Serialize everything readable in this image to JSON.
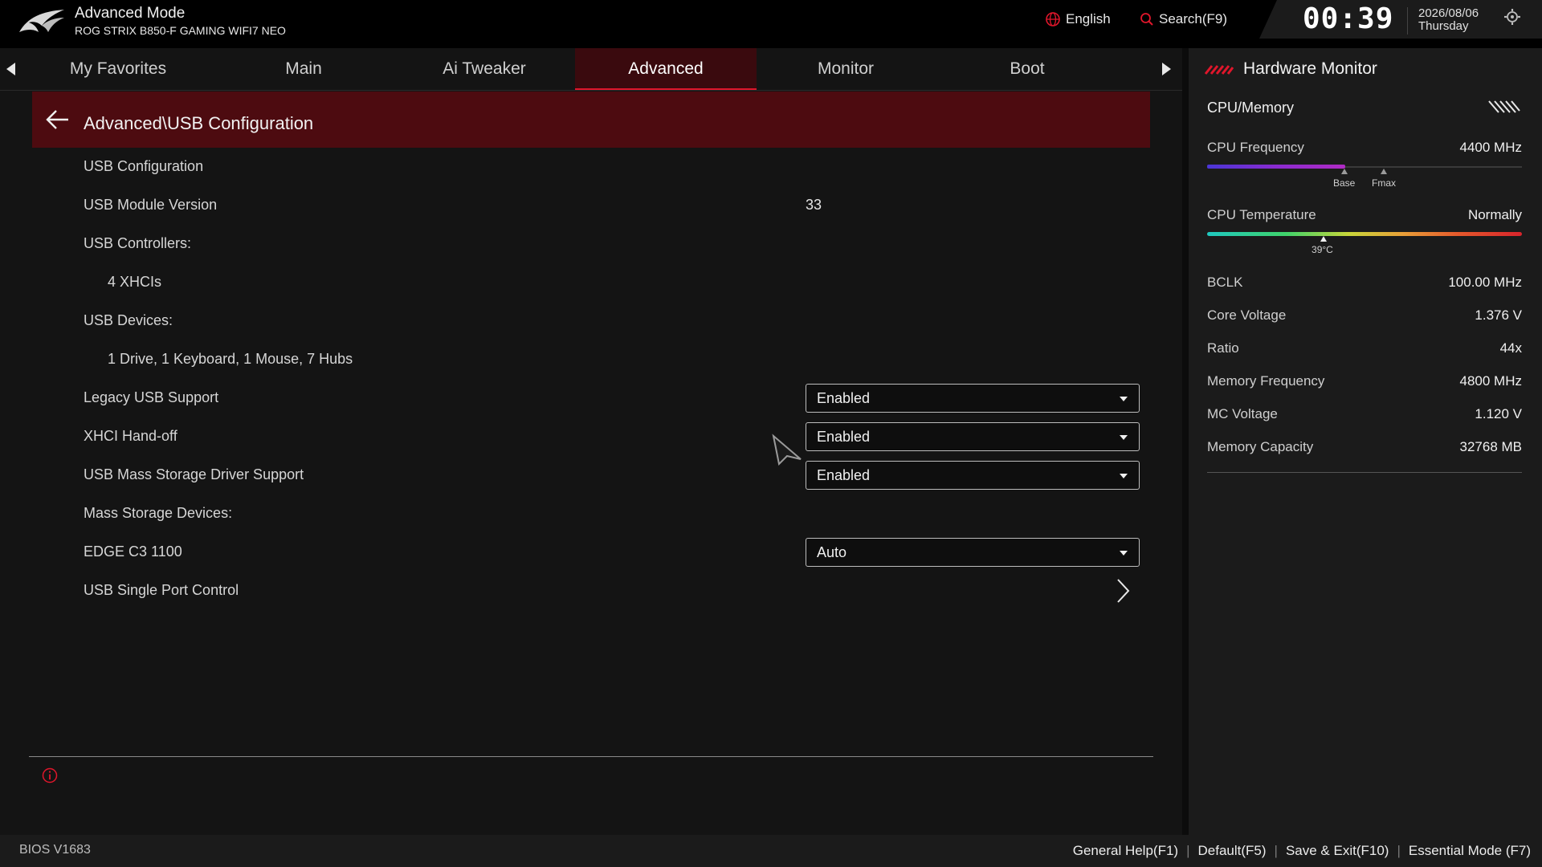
{
  "header": {
    "mode_title": "Advanced Mode",
    "board_name": "ROG STRIX B850-F GAMING WIFI7 NEO",
    "language": "English",
    "search": "Search(F9)",
    "clock": "00:39",
    "date": "2026/08/06",
    "weekday": "Thursday",
    "accent_color": "#e0162b"
  },
  "tabs": [
    {
      "label": "My Favorites"
    },
    {
      "label": "Main"
    },
    {
      "label": "Ai Tweaker"
    },
    {
      "label": "Advanced",
      "active": true
    },
    {
      "label": "Monitor"
    },
    {
      "label": "Boot"
    }
  ],
  "breadcrumb": "Advanced\\USB Configuration",
  "rows": {
    "usb_configuration": "USB Configuration",
    "usb_module_version": {
      "label": "USB Module Version",
      "value": "33"
    },
    "usb_controllers": {
      "label": "USB Controllers:",
      "value": "4 XHCIs"
    },
    "usb_devices": {
      "label": "USB Devices:",
      "value": "1 Drive, 1 Keyboard, 1 Mouse, 7 Hubs"
    },
    "legacy_usb_support": {
      "label": "Legacy USB Support",
      "value": "Enabled"
    },
    "xhci_handoff": {
      "label": "XHCI Hand-off",
      "value": "Enabled"
    },
    "usb_mass_storage_driver": {
      "label": "USB Mass Storage Driver Support",
      "value": "Enabled"
    },
    "mass_storage_devices": "Mass Storage Devices:",
    "edge_c3": {
      "label": "EDGE C3 1100",
      "value": "Auto"
    },
    "usb_single_port_control": "USB Single Port Control"
  },
  "hardware_monitor": {
    "title": "Hardware Monitor",
    "section": "CPU/Memory",
    "cpu_frequency": {
      "label": "CPU Frequency",
      "value": "4400 MHz",
      "fill_fraction": 0.44
    },
    "freq_markers": {
      "base": "Base",
      "fmax": "Fmax"
    },
    "cpu_temperature": {
      "label": "CPU Temperature",
      "value": "Normally",
      "reading": "39°C",
      "fraction": 0.37
    },
    "stats": [
      {
        "label": "BCLK",
        "value": "100.00 MHz"
      },
      {
        "label": "Core Voltage",
        "value": "1.376 V"
      },
      {
        "label": "Ratio",
        "value": "44x"
      },
      {
        "label": "Memory Frequency",
        "value": "4800 MHz"
      },
      {
        "label": "MC Voltage",
        "value": "1.120 V"
      },
      {
        "label": "Memory Capacity",
        "value": "32768 MB"
      }
    ]
  },
  "footer": {
    "bios_version": "BIOS V1683",
    "general_help": "General Help(F1)",
    "default": "Default(F5)",
    "save_exit": "Save & Exit(F10)",
    "essential_mode": "Essential Mode (F7)"
  }
}
